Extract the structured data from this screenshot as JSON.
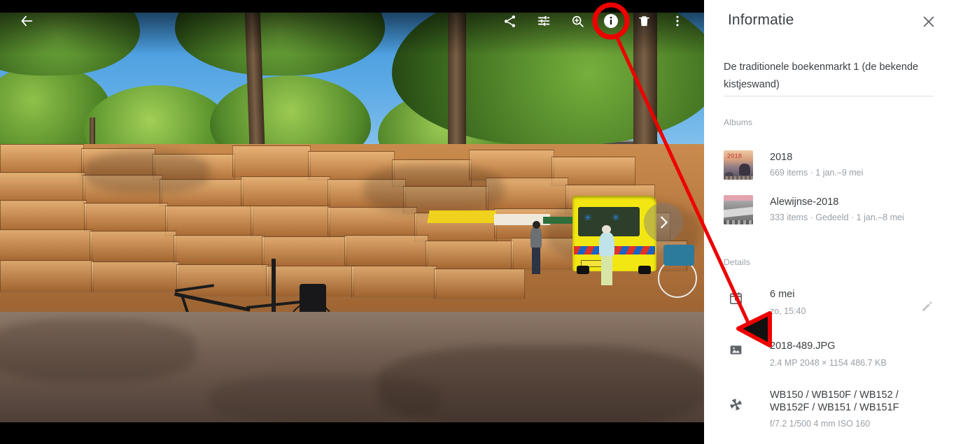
{
  "viewer": {
    "back_icon": "back-arrow-icon",
    "next_icon": "chevron-right-icon",
    "toolbar": [
      {
        "name": "share-button",
        "icon": "share-icon",
        "label": "Delen"
      },
      {
        "name": "edit-button",
        "icon": "tune-sliders-icon",
        "label": "Bewerken"
      },
      {
        "name": "zoom-button",
        "icon": "zoom-in-icon",
        "label": "Zoomen"
      },
      {
        "name": "info-button",
        "icon": "info-icon",
        "label": "Info"
      },
      {
        "name": "delete-button",
        "icon": "trash-icon",
        "label": "Verwijderen"
      },
      {
        "name": "more-options-button",
        "icon": "more-vertical-icon",
        "label": "Meer opties"
      }
    ],
    "photo_alt": "Boekenmarkt met houten kistjeswand, fietsen en gele ambulance op een plein"
  },
  "annotation": {
    "highlight_color": "#ee0000",
    "highlight_target": "info-button",
    "arrow_points_to": "details-section"
  },
  "panel": {
    "title": "Informatie",
    "close_icon": "close-icon",
    "description": "De traditionele boekenmarkt 1 (de bekende kistjeswand)",
    "albums_label": "Albums",
    "albums": [
      {
        "name": "2018",
        "meta": "669 items  ·  1 jan.–9 mei",
        "thumb_overlay_text": "2018",
        "thumb": "sunset-coast-thumb"
      },
      {
        "name": "Alewijnse-2018",
        "meta": "333 items  ·  Gedeeld  ·  1 jan.–8 mei",
        "thumb_overlay_text": "",
        "thumb": "grayscale-landscape-thumb"
      }
    ],
    "details_label": "Details",
    "details": [
      {
        "icon": "calendar-icon",
        "main": "6 mei",
        "sub": "zo, 15:40",
        "action_icon": "pencil-edit-icon"
      },
      {
        "icon": "image-icon",
        "main": "2018-489.JPG",
        "sub": "2.4 MP     2048 × 1154     486.7 KB"
      },
      {
        "icon": "aperture-camera-icon",
        "main_line1": "WB150 / WB150F / WB152 /",
        "main_line2": "WB152F / WB151 / WB151F",
        "sub": "f/7.2    1/500    4 mm    ISO 160"
      }
    ]
  },
  "colors": {
    "panel_bg": "#ffffff",
    "text_primary": "#3c4043",
    "text_secondary": "#9aa0a6",
    "viewer_bg": "#000000",
    "annotation_red": "#ee0000"
  }
}
